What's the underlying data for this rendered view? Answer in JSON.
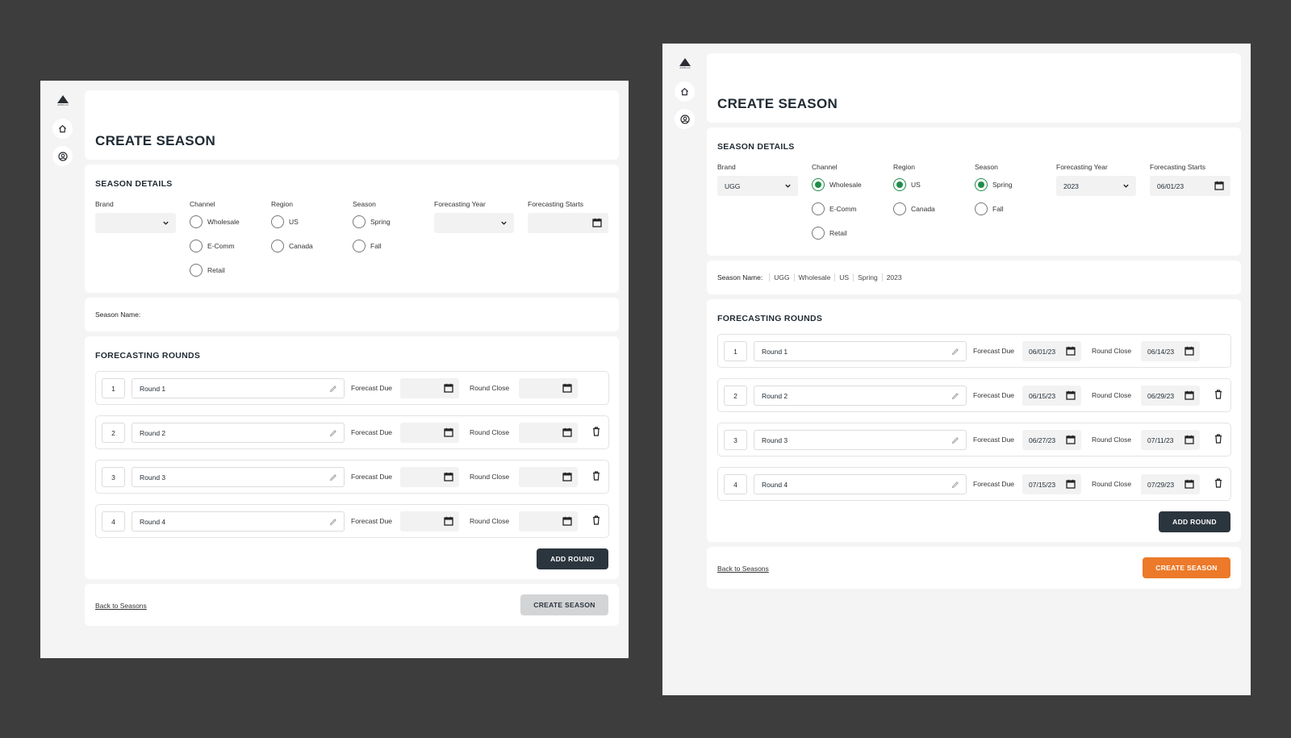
{
  "app": {
    "logo_text": "APOLLO"
  },
  "nav": {
    "home_icon": "home-icon",
    "account_icon": "user-circle-icon"
  },
  "colors": {
    "accent_orange": "#ec7a2a",
    "dark_button": "#2b353e",
    "radio_green": "#1e8e4a",
    "backdrop": "#3d3d3d"
  },
  "left": {
    "title": "CREATE SEASON",
    "details": {
      "heading": "SEASON DETAILS",
      "brand": {
        "label": "Brand",
        "value": ""
      },
      "channel": {
        "label": "Channel",
        "options": [
          "Wholesale",
          "E-Comm",
          "Retail"
        ],
        "selected": null
      },
      "region": {
        "label": "Region",
        "options": [
          "US",
          "Canada"
        ],
        "selected": null
      },
      "season": {
        "label": "Season",
        "options": [
          "Spring",
          "Fall"
        ],
        "selected": null
      },
      "forecasting_year": {
        "label": "Forecasting Year",
        "value": ""
      },
      "forecasting_starts": {
        "label": "Forecasting Starts",
        "value": ""
      }
    },
    "season_name": {
      "label": "Season Name:",
      "parts": []
    },
    "rounds": {
      "heading": "FORECASTING ROUNDS",
      "forecast_due_label": "Forecast Due",
      "round_close_label": "Round Close",
      "items": [
        {
          "num": "1",
          "name": "Round 1",
          "forecast_due": "",
          "round_close": ""
        },
        {
          "num": "2",
          "name": "Round 2",
          "forecast_due": "",
          "round_close": ""
        },
        {
          "num": "3",
          "name": "Round 3",
          "forecast_due": "",
          "round_close": ""
        },
        {
          "num": "4",
          "name": "Round 4",
          "forecast_due": "",
          "round_close": ""
        }
      ],
      "add_label": "ADD ROUND"
    },
    "footer": {
      "back_label": "Back to Seasons",
      "create_label": "CREATE SEASON",
      "create_state": "disabled"
    }
  },
  "right": {
    "title": "CREATE SEASON",
    "details": {
      "heading": "SEASON DETAILS",
      "brand": {
        "label": "Brand",
        "value": "UGG"
      },
      "channel": {
        "label": "Channel",
        "options": [
          "Wholesale",
          "E-Comm",
          "Retail"
        ],
        "selected": "Wholesale"
      },
      "region": {
        "label": "Region",
        "options": [
          "US",
          "Canada"
        ],
        "selected": "US"
      },
      "season": {
        "label": "Season",
        "options": [
          "Spring",
          "Fall"
        ],
        "selected": "Spring"
      },
      "forecasting_year": {
        "label": "Forecasting Year",
        "value": "2023"
      },
      "forecasting_starts": {
        "label": "Forecasting Starts",
        "value": "06/01/23"
      }
    },
    "season_name": {
      "label": "Season Name:",
      "parts": [
        "UGG",
        "Wholesale",
        "US",
        "Spring",
        "2023"
      ]
    },
    "rounds": {
      "heading": "FORECASTING ROUNDS",
      "forecast_due_label": "Forecast Due",
      "round_close_label": "Round Close",
      "items": [
        {
          "num": "1",
          "name": "Round 1",
          "forecast_due": "06/01/23",
          "round_close": "06/14/23"
        },
        {
          "num": "2",
          "name": "Round 2",
          "forecast_due": "06/15/23",
          "round_close": "06/29/23"
        },
        {
          "num": "3",
          "name": "Round 3",
          "forecast_due": "06/27/23",
          "round_close": "07/11/23"
        },
        {
          "num": "4",
          "name": "Round 4",
          "forecast_due": "07/15/23",
          "round_close": "07/29/23"
        }
      ],
      "add_label": "ADD ROUND"
    },
    "footer": {
      "back_label": "Back to Seasons",
      "create_label": "CREATE SEASON",
      "create_state": "active"
    }
  }
}
